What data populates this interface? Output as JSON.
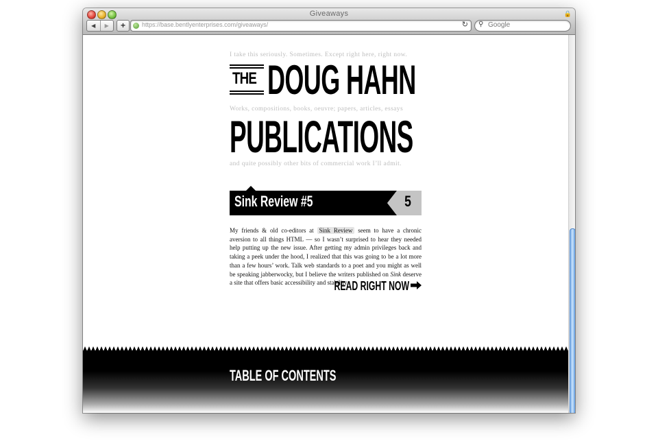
{
  "window": {
    "title": "Giveaways",
    "url": "https://base.bentlyenterprises.com/giveaways/",
    "search_placeholder": "Google"
  },
  "header": {
    "tagline_1": "I take this seriously. Sometimes. Except right here, right now.",
    "the": "THE",
    "name": "DOUG HAHN",
    "tagline_2": "Works, compositions, books, oeuvre; papers, articles, essays",
    "publications": "PUBLICATIONS",
    "tagline_3": "and quite possibly other bits of commercial work I’ll admit."
  },
  "entry": {
    "title": "Sink Review #5",
    "number": "5",
    "p_a": "My friends & old co-editors at",
    "link": "Sink Review",
    "p_b": "seem to have a chronic aversion to all things HTML — so I wasn’t surprised to hear they needed help putting up the new issue. After getting my admin privileges back and taking a peek under the hood, I realized that this was going to be a lot more than a few hours’ work. Talk web standards to a poet and you might as well be speaking jabberwocky, but I believe the writers published on",
    "sink": "Sink",
    "p_c": "deserve a site that offers basic accessibility and stability.",
    "read_label": "READ RIGHT NOW"
  },
  "footer": {
    "toc": "TABLE OF CONTENTS"
  }
}
